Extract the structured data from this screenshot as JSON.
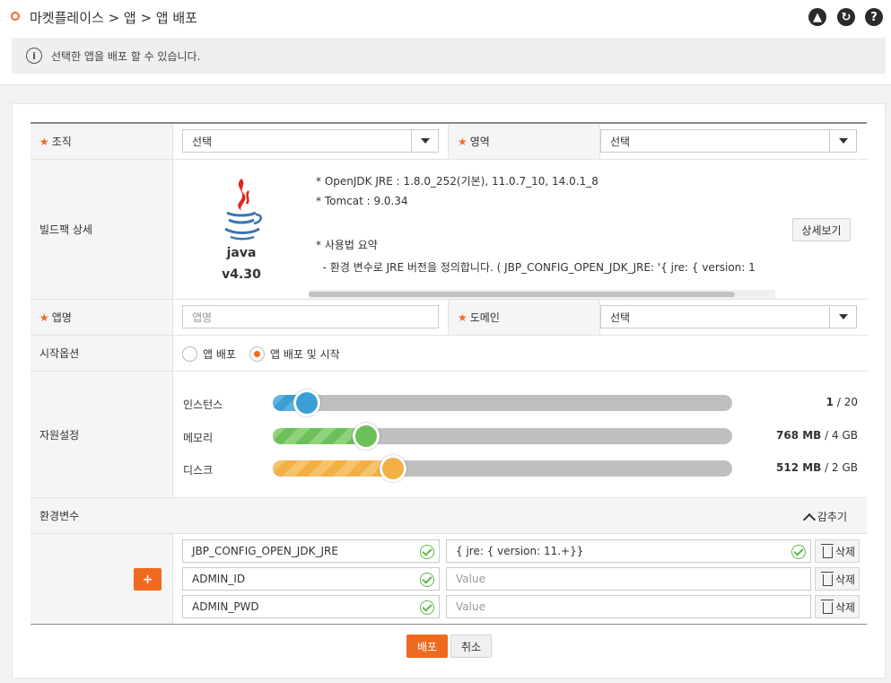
{
  "breadcrumb": "마켓플레이스 > 앱 > 앱 배포",
  "header_icons": [
    "user-icon",
    "refresh-icon",
    "help-icon"
  ],
  "info": {
    "icon": "info-icon",
    "text": "선택한 앱을 배포 할 수 있습니다."
  },
  "form": {
    "org": {
      "label": "조직",
      "value": "선택"
    },
    "area": {
      "label": "영역",
      "value": "선택"
    },
    "buildpack": {
      "label": "빌드팩 상세",
      "name": "java",
      "version": "v4.30",
      "lines": [
        "* OpenJDK JRE : 1.8.0_252(기본), 11.0.7_10, 14.0.1_8",
        "* Tomcat : 9.0.34",
        "* 사용법 요약",
        "  - 환경 변수로 JRE 버전을 정의합니다. ( JBP_CONFIG_OPEN_JDK_JRE: '{ jre: { version: 1"
      ],
      "detail_button": "상세보기"
    },
    "app_name": {
      "label": "앱명",
      "placeholder": "앱명"
    },
    "domain": {
      "label": "도메인",
      "value": "선택"
    },
    "start_option": {
      "label": "시작옵션",
      "options": [
        "앱 배포",
        "앱 배포 및 시작"
      ],
      "selected": "앱 배포 및 시작"
    },
    "resources": {
      "label": "자원설정",
      "items": [
        {
          "name": "인스턴스",
          "value": "1",
          "max": "/ 20",
          "fraction": 0.05,
          "color": "#3b9fd4"
        },
        {
          "name": "메모리",
          "value": "768 MB",
          "max": "/ 4 GB",
          "fraction": 0.1875,
          "color": "#6cc05a"
        },
        {
          "name": "디스크",
          "value": "512 MB",
          "max": "/ 2 GB",
          "fraction": 0.25,
          "color": "#f2b045"
        }
      ]
    },
    "env": {
      "label": "환경변수",
      "toggle": "감추기",
      "add_button": "+",
      "delete_label": "삭제",
      "value_placeholder": "Value",
      "rows": [
        {
          "key": "JBP_CONFIG_OPEN_JDK_JRE",
          "value": "{ jre: { version: 11.+}}"
        },
        {
          "key": "ADMIN_ID",
          "value": ""
        },
        {
          "key": "ADMIN_PWD",
          "value": ""
        }
      ]
    }
  },
  "actions": {
    "deploy": "배포",
    "cancel": "취소"
  },
  "colors": {
    "accent": "#ef6a1f"
  }
}
